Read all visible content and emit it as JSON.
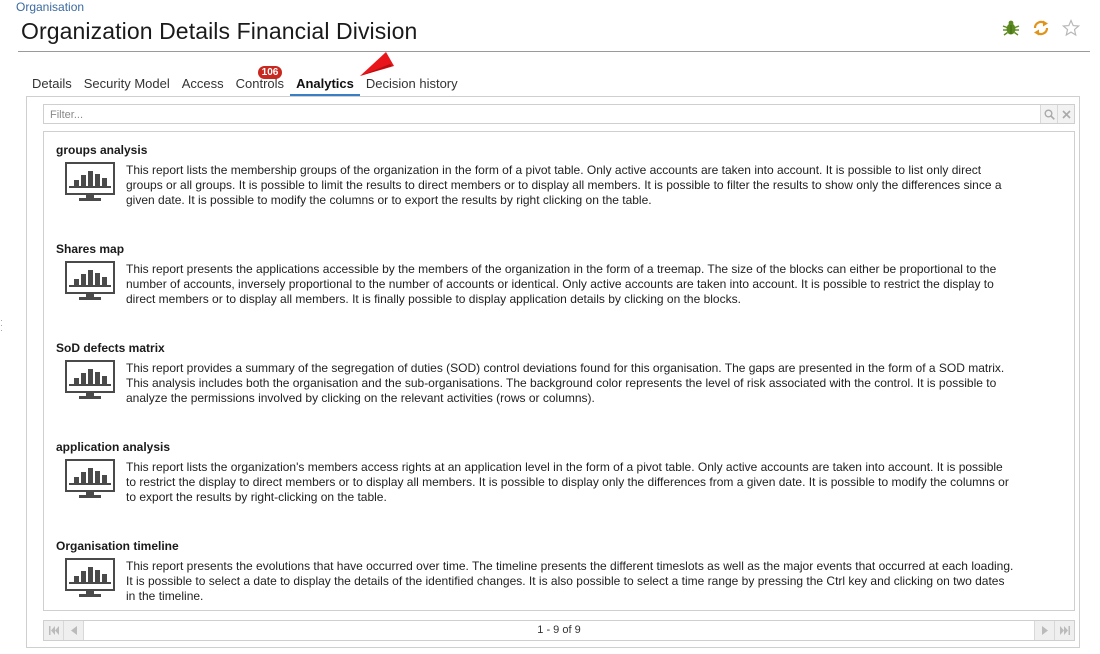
{
  "breadcrumb": "Organisation",
  "page_title": "Organization Details Financial Division",
  "tabs": [
    {
      "label": "Details"
    },
    {
      "label": "Security Model"
    },
    {
      "label": "Access"
    },
    {
      "label": "Controls",
      "badge": "106"
    },
    {
      "label": "Analytics",
      "active": true
    },
    {
      "label": "Decision history"
    }
  ],
  "filter": {
    "placeholder": "Filter..."
  },
  "reports": [
    {
      "title": "groups analysis",
      "description": "This report lists the membership groups of the organization in the form of a pivot table. Only active accounts are taken into account. It is possible to list only direct groups or all groups. It is possible to limit the results to direct members or to display all members. It is possible to filter the results to show only the differences since a given date. It is possible to modify the columns or to export the results by right clicking on the table."
    },
    {
      "title": "Shares map",
      "description": "This report presents the applications accessible by the members of the organization in the form of a treemap. The size of the blocks can either be proportional to the number of accounts, inversely proportional to the number of accounts or identical. Only active accounts are taken into account. It is possible to restrict the display to direct members or to display all members. It is finally possible to display application details by clicking on the blocks."
    },
    {
      "title": "SoD defects matrix",
      "description": "This report provides a summary of the segregation of duties (SOD) control deviations found for this organisation. The gaps are presented in the form of a SOD matrix. This analysis includes both the organisation and the sub-organisations. The background color represents the level of risk associated with the control. It is possible to analyze the permissions involved by clicking on the relevant activities (rows or columns)."
    },
    {
      "title": "application analysis",
      "description": "This report lists the organization's members access rights at an application level in the form of a pivot table. Only active accounts are taken into account. It is possible to restrict the display to direct members or to display all members. It is possible to display only the differences from a given date. It is possible to modify the columns or to export the results by right-clicking on the table."
    },
    {
      "title": "Organisation timeline",
      "description": "This report presents the evolutions that have occurred over time. The timeline presents the different timeslots as well as the major events that occurred at each loading. It is possible to select a date to display the details of the identified changes. It is also possible to select a time range by pressing the Ctrl key and clicking on two dates in the timeline."
    }
  ],
  "pager": {
    "count": "1 - 9 of 9"
  },
  "header_icons": [
    "bug-icon",
    "refresh-icon",
    "star-icon"
  ],
  "colors": {
    "accent": "#3a7fc4",
    "badge": "#c8281e",
    "arrow": "#e8161b"
  }
}
